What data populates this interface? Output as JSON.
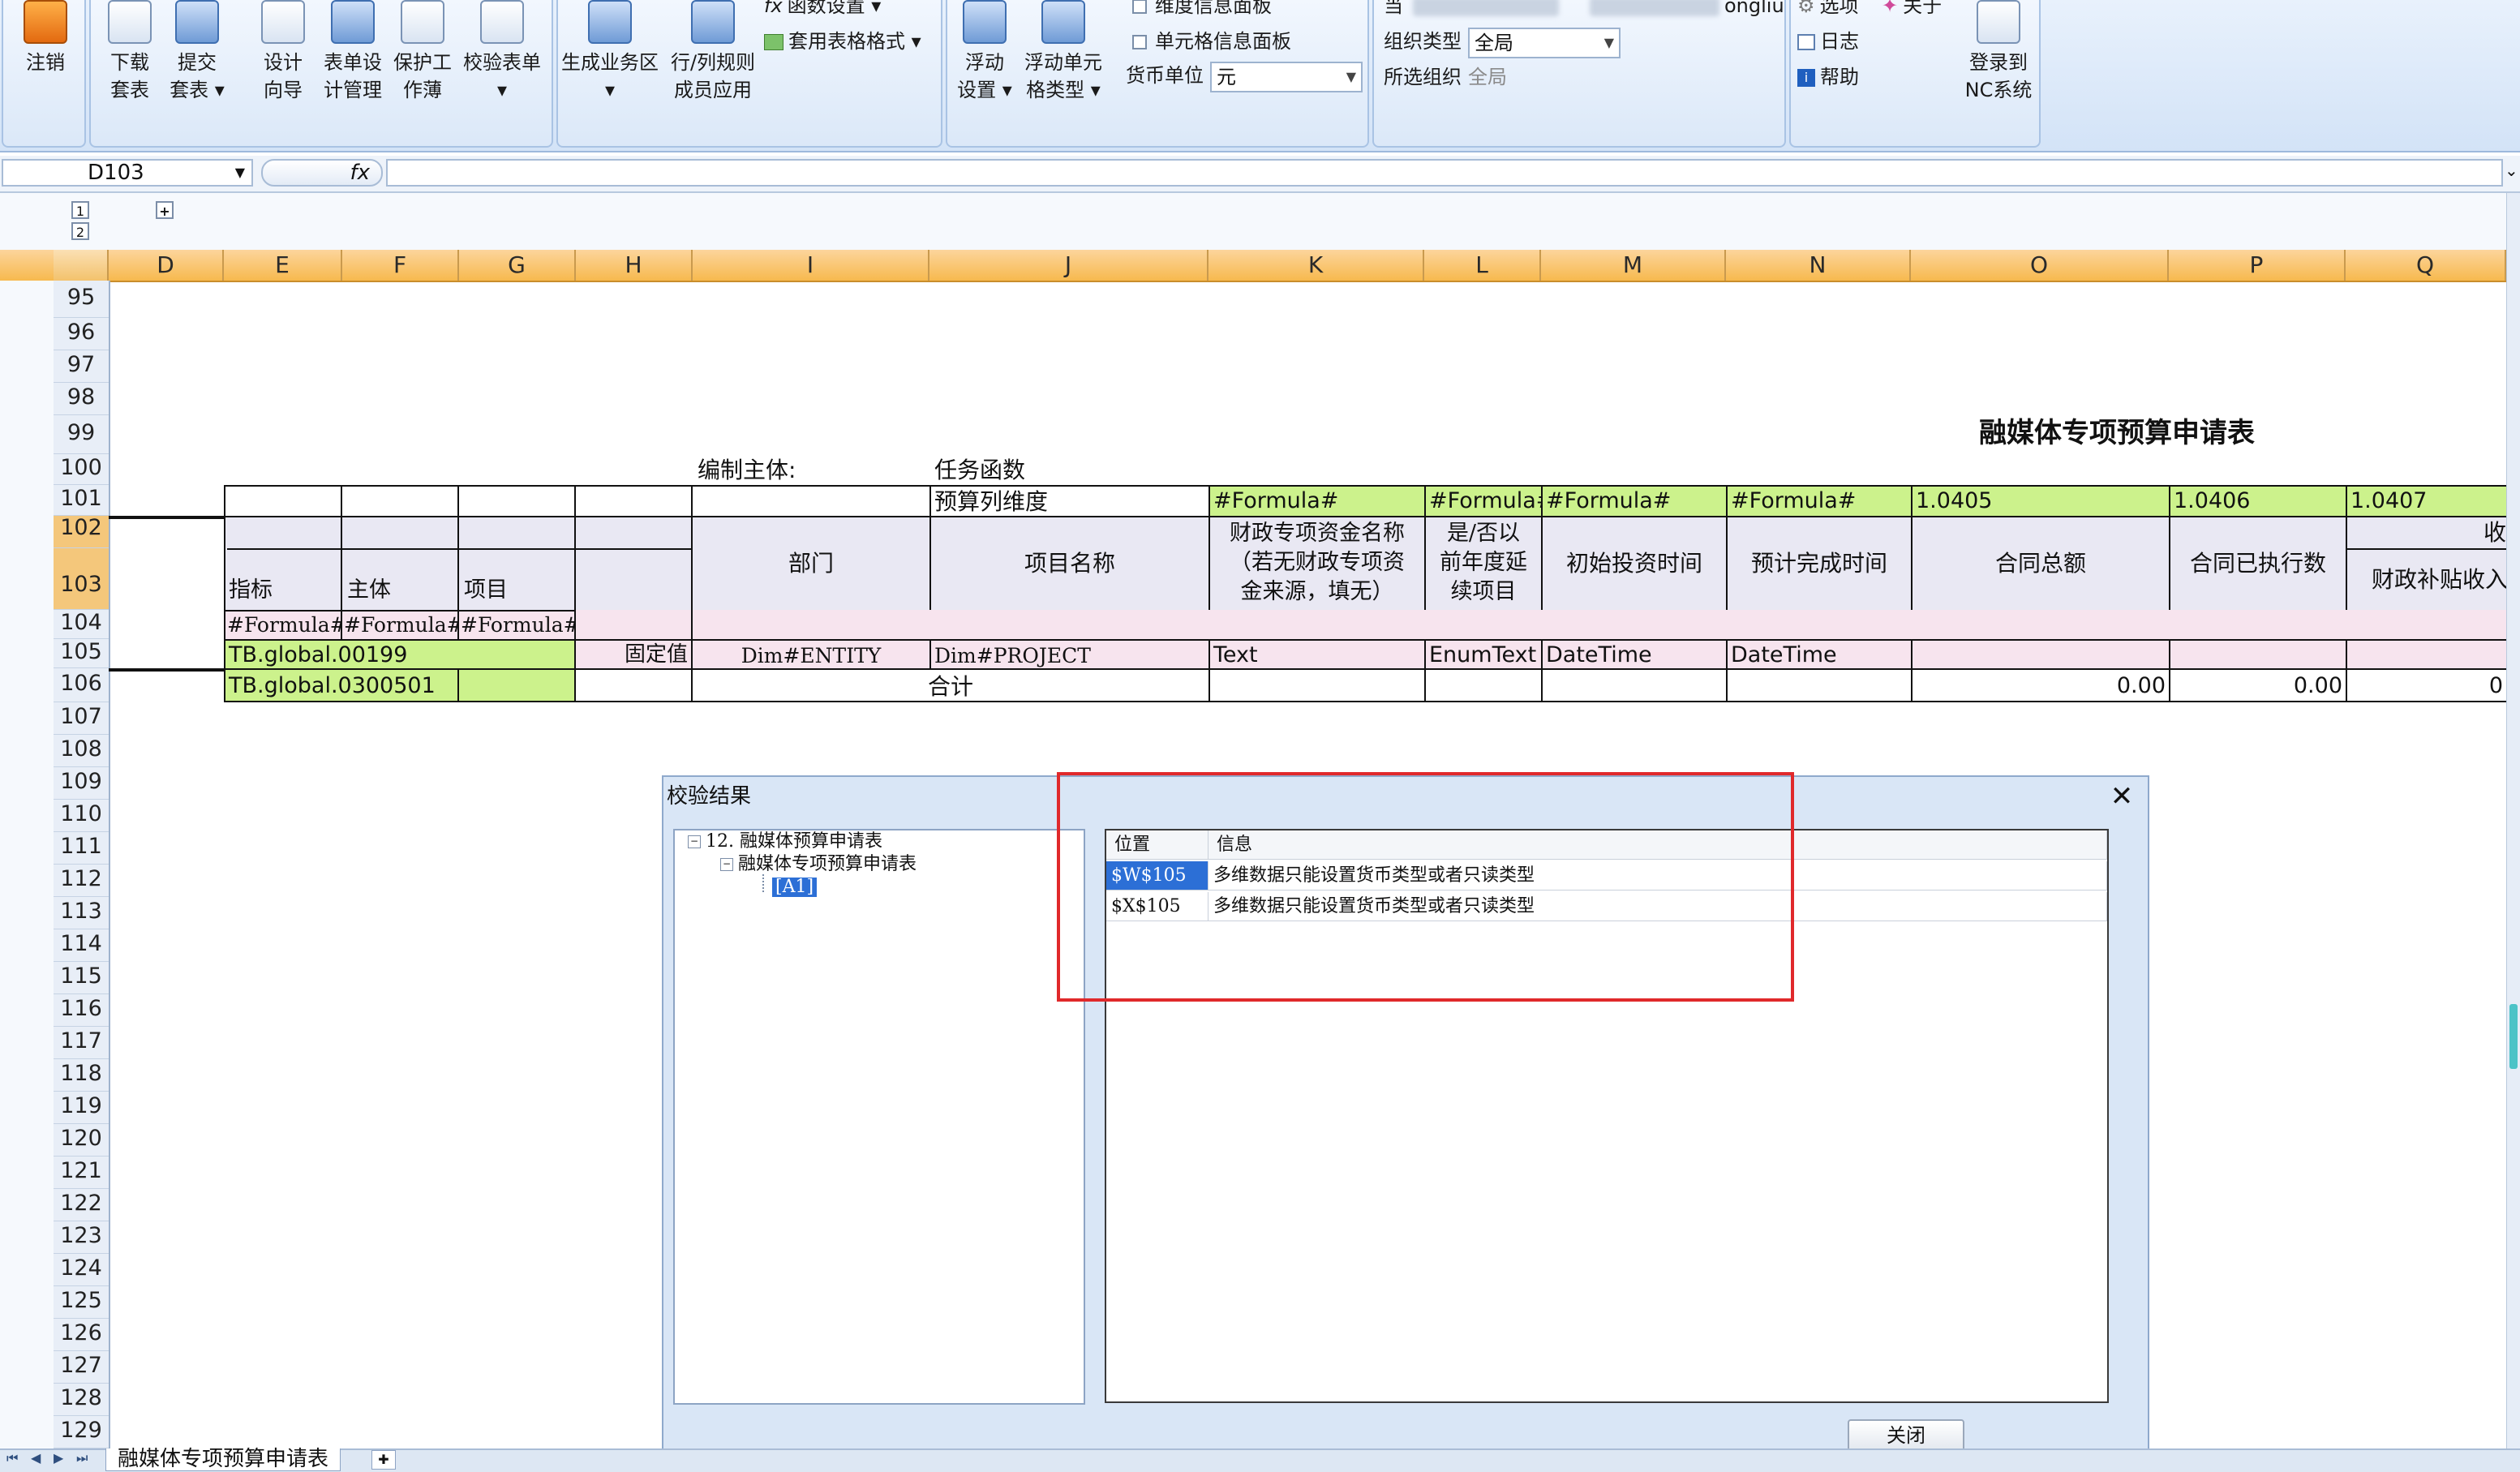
{
  "ribbon": {
    "logout": "注销",
    "download": [
      "下载",
      "套表"
    ],
    "submit": [
      "提交",
      "套表 ▾"
    ],
    "design": [
      "设计",
      "向导"
    ],
    "form_design": [
      "表单设",
      "计管理"
    ],
    "protect": [
      "保护工",
      "作薄"
    ],
    "validate": "校验表单",
    "validate_arrow": "▾",
    "gen_business": "生成业务区",
    "gen_arrow": "▾",
    "rowcol_rule": [
      "行/列规则",
      "成员应用"
    ],
    "func_settings": "函数设置 ▾",
    "apply_table_format": "套用表格格式 ▾",
    "float_settings": [
      "浮动",
      "设置 ▾"
    ],
    "float_cell": [
      "浮动单元",
      "格类型 ▾"
    ],
    "dim_info_panel": "维度信息面板",
    "cell_info_panel": "单元格信息面板",
    "currency_label": "货币单位",
    "currency_value": "元",
    "current_label": "当",
    "org_type_label": "组织类型",
    "org_type_value": "全局",
    "org_label": "所选组织",
    "org_value": "全局",
    "user_suffix": "ongliu",
    "options": "选项",
    "about": "关于",
    "log": "日志",
    "help": "帮助",
    "login_nc": [
      "登录到",
      "NC系统"
    ]
  },
  "formula_bar": {
    "cell_ref": "D103",
    "fx": "fx"
  },
  "outline": {
    "levels": [
      "1",
      "2"
    ],
    "col_levels": [
      "1",
      "2"
    ]
  },
  "columns": [
    "D",
    "E",
    "F",
    "G",
    "H",
    "I",
    "J",
    "K",
    "L",
    "M",
    "N",
    "O",
    "P",
    "Q"
  ],
  "rows": [
    "95",
    "96",
    "97",
    "98",
    "99",
    "100",
    "101",
    "102",
    "103",
    "104",
    "105",
    "106",
    "107",
    "108",
    "109",
    "110",
    "111",
    "112",
    "113",
    "114",
    "115",
    "116",
    "117",
    "118",
    "119",
    "120",
    "121",
    "122",
    "123",
    "124",
    "125",
    "126",
    "127",
    "128",
    "129"
  ],
  "sheet": {
    "title": "融媒体专项预算申请表",
    "compiler_label": "编制主体:",
    "task_func": "任务函数",
    "r101": {
      "J": "预算列维度",
      "K": "#Formula#",
      "L": "#Formula#",
      "M": "#Formula#",
      "N": "#Formula#",
      "O": "1.0405",
      "P": "1.0406",
      "Q": "1.0407"
    },
    "header": {
      "E": "指标",
      "F": "主体",
      "G": "项目",
      "I": "部门",
      "J": "项目名称",
      "K": [
        "财政专项资金名称",
        "（若无财政专项资",
        "金来源，填无）"
      ],
      "L": [
        "是/否以",
        "前年度延",
        "续项目"
      ],
      "M": "初始投资时间",
      "N": "预计完成时间",
      "O": "合同总额",
      "P": "合同已执行数",
      "Q_top": "收",
      "Q": "财政补贴收入"
    },
    "r104": {
      "E": "#Formula#",
      "F": "#Formula#",
      "G": "#Formula#"
    },
    "r105": {
      "E": "TB.global.00199",
      "H": "固定值",
      "I": "Dim#ENTITY",
      "J": "Dim#PROJECT",
      "K": "Text",
      "L": "EnumText",
      "M": "DateTime",
      "N": "DateTime"
    },
    "r106": {
      "E": "TB.global.0300501",
      "total": "合计",
      "O": "0.00",
      "P": "0.00",
      "Q": "0"
    }
  },
  "dialog": {
    "title": "校验结果",
    "close_glyph": "✕",
    "tree": {
      "root": "12. 融媒体预算申请表",
      "child": "融媒体专项预算申请表",
      "leaf": "[A1]"
    },
    "grid_headers": [
      "位置",
      "信息"
    ],
    "grid_rows": [
      {
        "pos": "$W$105",
        "info": "多维数据只能设置货币类型或者只读类型"
      },
      {
        "pos": "$X$105",
        "info": "多维数据只能设置货币类型或者只读类型"
      }
    ],
    "close_button": "关闭"
  },
  "tabs": {
    "sheet_name": "融媒体专项预算申请表"
  }
}
